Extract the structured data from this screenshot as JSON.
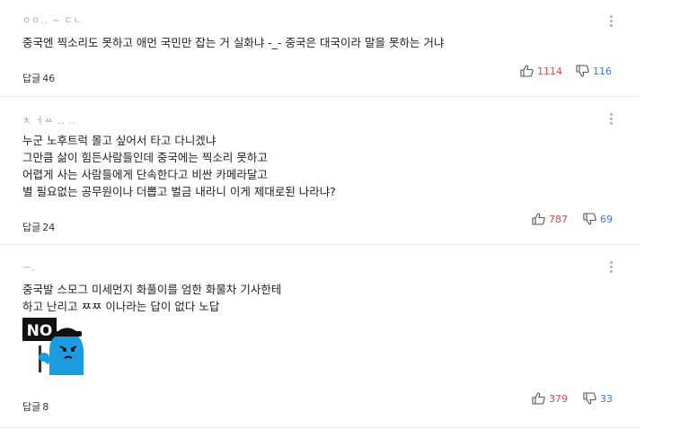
{
  "comments": [
    {
      "meta": "ㅇㅇ.. ~ ㄷㄴ",
      "lines": [
        "중국엔 찍소리도 못하고 애먼 국민만 잡는 거 실화냐 -_- 중국은 대국이라 말을 못하는 거냐"
      ],
      "reply_label": "답글",
      "reply_count": "46",
      "likes": "1114",
      "dislikes": "116"
    },
    {
      "meta": "ㅊ ㅓㅆ .. ..",
      "lines": [
        "누군 노후트럭 몰고 싶어서 타고 다니겠냐",
        "그만큼 삶이 힘든사람들인데 중국에는 찍소리 못하고",
        "어렵게 사는 사람들에게 단속한다고 비싼 카메라달고",
        "별 필요없는 공무원이나 더뽑고 벌금 내라니 이게 제대로된 나라냐?"
      ],
      "reply_label": "답글",
      "reply_count": "24",
      "likes": "787",
      "dislikes": "69"
    },
    {
      "meta": "ㅡ.",
      "lines": [
        "중국발 스모그 미세먼지 화풀이를 엄한 화물차 기사한테",
        "하고 난리고 ㅉㅉ 이나라는 답이 없다 노답"
      ],
      "sticker_text": "NO",
      "reply_label": "답글",
      "reply_count": "8",
      "likes": "379",
      "dislikes": "33"
    }
  ],
  "colors": {
    "like": "#e0454a",
    "dislike": "#3b76d8",
    "divider": "#ececec"
  },
  "icons": {
    "like": "thumbs-up-icon",
    "dislike": "thumbs-down-icon",
    "more": "more-vertical-icon"
  }
}
